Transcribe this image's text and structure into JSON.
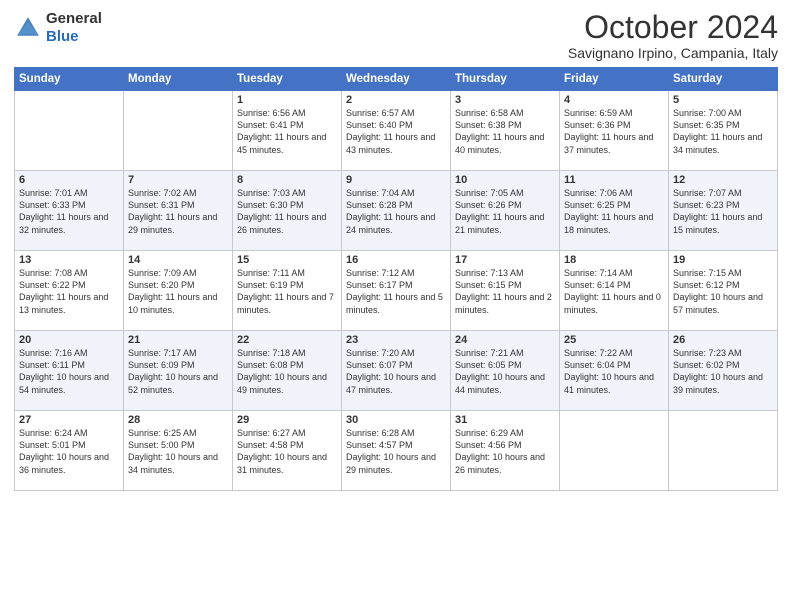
{
  "logo": {
    "general": "General",
    "blue": "Blue"
  },
  "header": {
    "month": "October 2024",
    "location": "Savignano Irpino, Campania, Italy"
  },
  "weekdays": [
    "Sunday",
    "Monday",
    "Tuesday",
    "Wednesday",
    "Thursday",
    "Friday",
    "Saturday"
  ],
  "weeks": [
    [
      {
        "day": "",
        "info": ""
      },
      {
        "day": "",
        "info": ""
      },
      {
        "day": "1",
        "info": "Sunrise: 6:56 AM\nSunset: 6:41 PM\nDaylight: 11 hours and 45 minutes."
      },
      {
        "day": "2",
        "info": "Sunrise: 6:57 AM\nSunset: 6:40 PM\nDaylight: 11 hours and 43 minutes."
      },
      {
        "day": "3",
        "info": "Sunrise: 6:58 AM\nSunset: 6:38 PM\nDaylight: 11 hours and 40 minutes."
      },
      {
        "day": "4",
        "info": "Sunrise: 6:59 AM\nSunset: 6:36 PM\nDaylight: 11 hours and 37 minutes."
      },
      {
        "day": "5",
        "info": "Sunrise: 7:00 AM\nSunset: 6:35 PM\nDaylight: 11 hours and 34 minutes."
      }
    ],
    [
      {
        "day": "6",
        "info": "Sunrise: 7:01 AM\nSunset: 6:33 PM\nDaylight: 11 hours and 32 minutes."
      },
      {
        "day": "7",
        "info": "Sunrise: 7:02 AM\nSunset: 6:31 PM\nDaylight: 11 hours and 29 minutes."
      },
      {
        "day": "8",
        "info": "Sunrise: 7:03 AM\nSunset: 6:30 PM\nDaylight: 11 hours and 26 minutes."
      },
      {
        "day": "9",
        "info": "Sunrise: 7:04 AM\nSunset: 6:28 PM\nDaylight: 11 hours and 24 minutes."
      },
      {
        "day": "10",
        "info": "Sunrise: 7:05 AM\nSunset: 6:26 PM\nDaylight: 11 hours and 21 minutes."
      },
      {
        "day": "11",
        "info": "Sunrise: 7:06 AM\nSunset: 6:25 PM\nDaylight: 11 hours and 18 minutes."
      },
      {
        "day": "12",
        "info": "Sunrise: 7:07 AM\nSunset: 6:23 PM\nDaylight: 11 hours and 15 minutes."
      }
    ],
    [
      {
        "day": "13",
        "info": "Sunrise: 7:08 AM\nSunset: 6:22 PM\nDaylight: 11 hours and 13 minutes."
      },
      {
        "day": "14",
        "info": "Sunrise: 7:09 AM\nSunset: 6:20 PM\nDaylight: 11 hours and 10 minutes."
      },
      {
        "day": "15",
        "info": "Sunrise: 7:11 AM\nSunset: 6:19 PM\nDaylight: 11 hours and 7 minutes."
      },
      {
        "day": "16",
        "info": "Sunrise: 7:12 AM\nSunset: 6:17 PM\nDaylight: 11 hours and 5 minutes."
      },
      {
        "day": "17",
        "info": "Sunrise: 7:13 AM\nSunset: 6:15 PM\nDaylight: 11 hours and 2 minutes."
      },
      {
        "day": "18",
        "info": "Sunrise: 7:14 AM\nSunset: 6:14 PM\nDaylight: 11 hours and 0 minutes."
      },
      {
        "day": "19",
        "info": "Sunrise: 7:15 AM\nSunset: 6:12 PM\nDaylight: 10 hours and 57 minutes."
      }
    ],
    [
      {
        "day": "20",
        "info": "Sunrise: 7:16 AM\nSunset: 6:11 PM\nDaylight: 10 hours and 54 minutes."
      },
      {
        "day": "21",
        "info": "Sunrise: 7:17 AM\nSunset: 6:09 PM\nDaylight: 10 hours and 52 minutes."
      },
      {
        "day": "22",
        "info": "Sunrise: 7:18 AM\nSunset: 6:08 PM\nDaylight: 10 hours and 49 minutes."
      },
      {
        "day": "23",
        "info": "Sunrise: 7:20 AM\nSunset: 6:07 PM\nDaylight: 10 hours and 47 minutes."
      },
      {
        "day": "24",
        "info": "Sunrise: 7:21 AM\nSunset: 6:05 PM\nDaylight: 10 hours and 44 minutes."
      },
      {
        "day": "25",
        "info": "Sunrise: 7:22 AM\nSunset: 6:04 PM\nDaylight: 10 hours and 41 minutes."
      },
      {
        "day": "26",
        "info": "Sunrise: 7:23 AM\nSunset: 6:02 PM\nDaylight: 10 hours and 39 minutes."
      }
    ],
    [
      {
        "day": "27",
        "info": "Sunrise: 6:24 AM\nSunset: 5:01 PM\nDaylight: 10 hours and 36 minutes."
      },
      {
        "day": "28",
        "info": "Sunrise: 6:25 AM\nSunset: 5:00 PM\nDaylight: 10 hours and 34 minutes."
      },
      {
        "day": "29",
        "info": "Sunrise: 6:27 AM\nSunset: 4:58 PM\nDaylight: 10 hours and 31 minutes."
      },
      {
        "day": "30",
        "info": "Sunrise: 6:28 AM\nSunset: 4:57 PM\nDaylight: 10 hours and 29 minutes."
      },
      {
        "day": "31",
        "info": "Sunrise: 6:29 AM\nSunset: 4:56 PM\nDaylight: 10 hours and 26 minutes."
      },
      {
        "day": "",
        "info": ""
      },
      {
        "day": "",
        "info": ""
      }
    ]
  ]
}
